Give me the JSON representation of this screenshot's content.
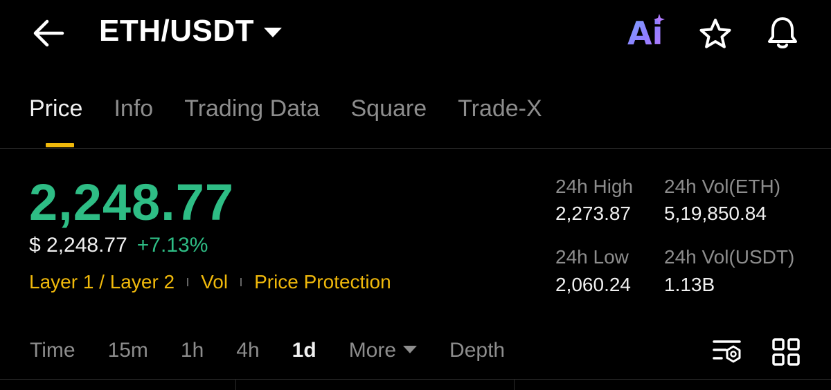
{
  "header": {
    "pair": "ETH/USDT",
    "ai_label": "Ai"
  },
  "tabs": [
    {
      "label": "Price",
      "active": true
    },
    {
      "label": "Info"
    },
    {
      "label": "Trading Data"
    },
    {
      "label": "Square"
    },
    {
      "label": "Trade-X"
    }
  ],
  "price": {
    "last": "2,248.77",
    "fiat": "$ 2,248.77",
    "change": "+7.13%"
  },
  "tags": [
    "Layer 1 / Layer 2",
    "Vol",
    "Price Protection"
  ],
  "stats": {
    "high_label": "24h High",
    "high_value": "2,273.87",
    "vol_base_label": "24h Vol(ETH)",
    "vol_base_value": "5,19,850.84",
    "low_label": "24h Low",
    "low_value": "2,060.24",
    "vol_quote_label": "24h Vol(USDT)",
    "vol_quote_value": "1.13B"
  },
  "intervals": [
    {
      "label": "Time"
    },
    {
      "label": "15m"
    },
    {
      "label": "1h"
    },
    {
      "label": "4h"
    },
    {
      "label": "1d",
      "active": true
    },
    {
      "label": "More"
    },
    {
      "label": "Depth"
    }
  ],
  "colors": {
    "up": "#2ebd85",
    "accent": "#f0b90b",
    "muted": "#8d8d8d",
    "background": "#000000"
  },
  "icons": [
    "back-arrow-icon",
    "caret-down-icon",
    "ai-icon",
    "star-icon",
    "bell-icon",
    "indicator-settings-icon",
    "grid-layout-icon"
  ]
}
